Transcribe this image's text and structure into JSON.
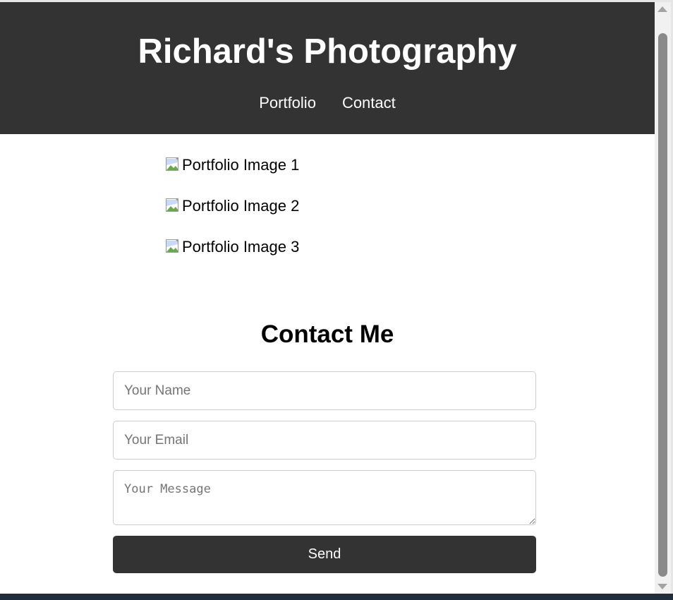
{
  "header": {
    "title": "Richard's Photography",
    "nav": [
      {
        "label": "Portfolio"
      },
      {
        "label": "Contact"
      }
    ]
  },
  "portfolio": {
    "images": [
      {
        "alt": "Portfolio Image 1",
        "icon": "broken-image-icon"
      },
      {
        "alt": "Portfolio Image 2",
        "icon": "broken-image-icon"
      },
      {
        "alt": "Portfolio Image 3",
        "icon": "broken-image-icon"
      }
    ]
  },
  "contact": {
    "heading": "Contact Me",
    "name_placeholder": "Your Name",
    "email_placeholder": "Your Email",
    "message_placeholder": "Your Message",
    "send_label": "Send"
  },
  "colors": {
    "header_bg": "#333333",
    "header_text": "#ffffff",
    "button_bg": "#333333",
    "button_text": "#ffffff",
    "field_border": "#cccccc"
  }
}
